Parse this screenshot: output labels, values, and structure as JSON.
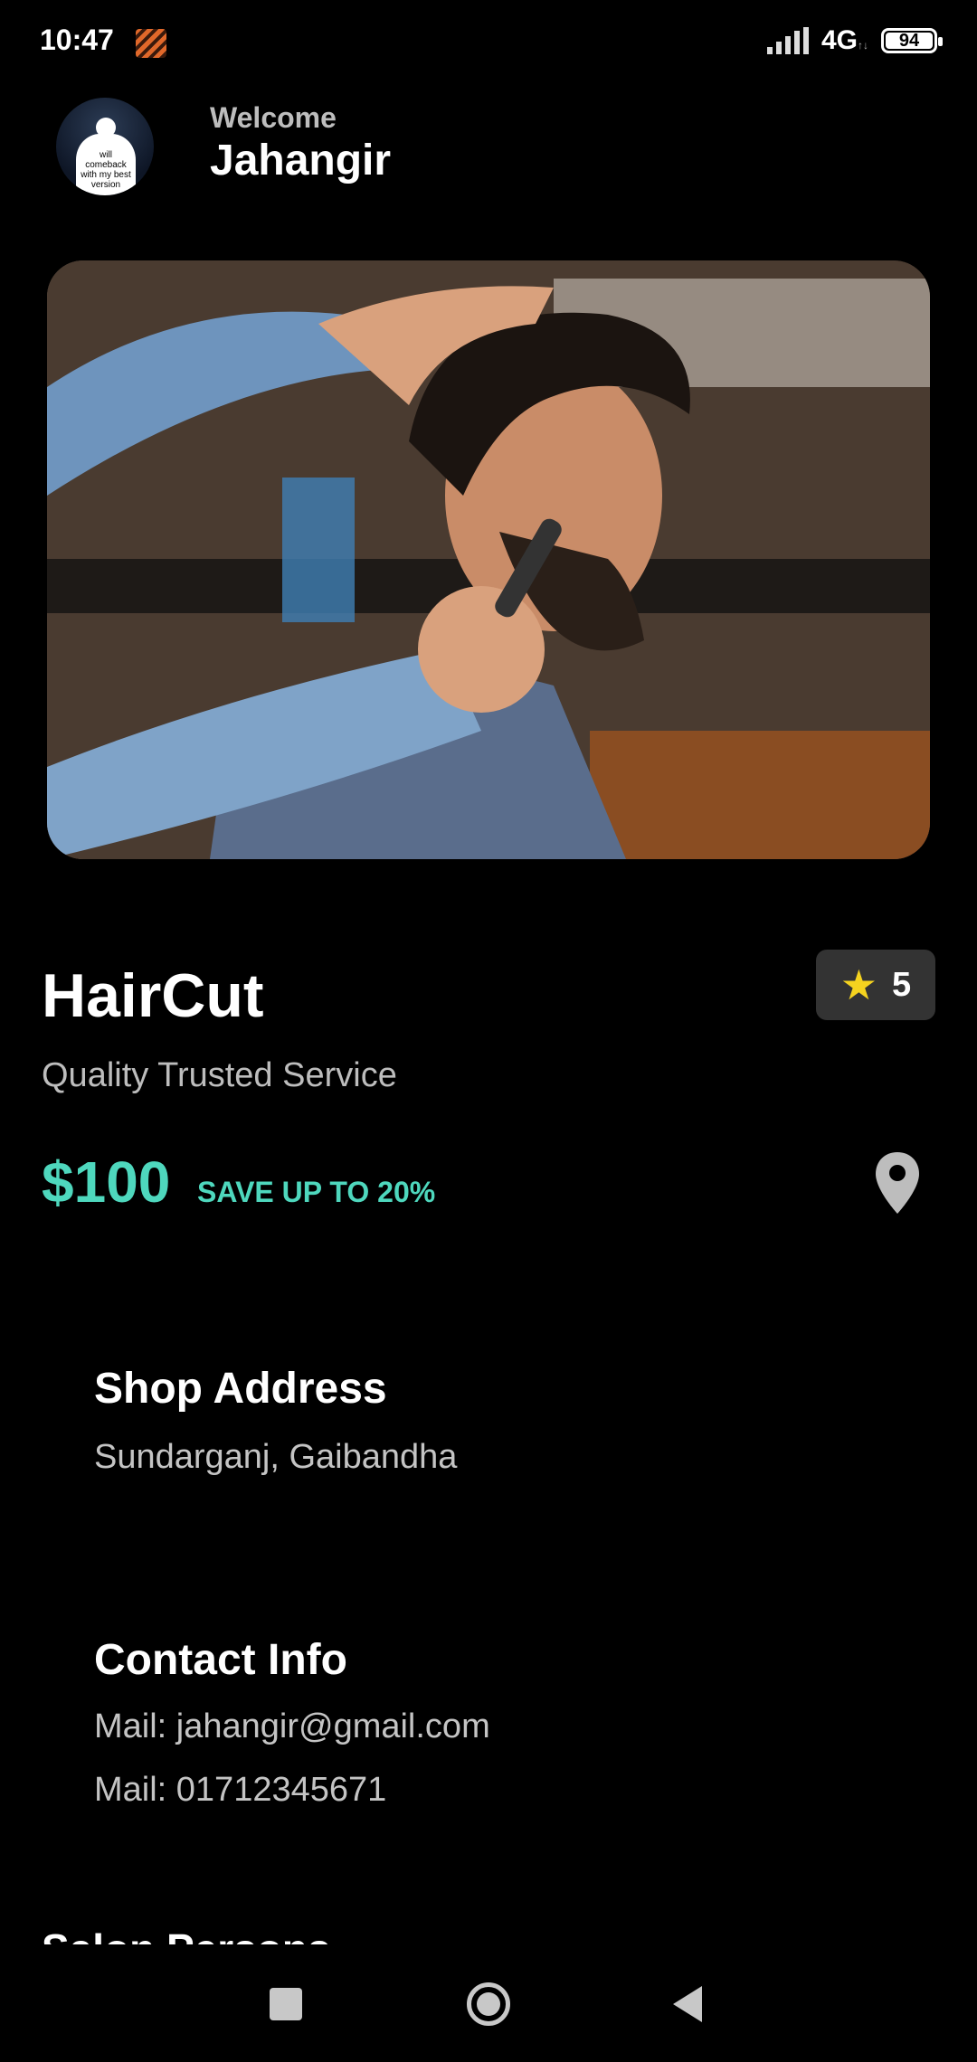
{
  "status_bar": {
    "time": "10:47",
    "network": "4G",
    "battery": "94"
  },
  "header": {
    "welcome": "Welcome",
    "username": "Jahangir",
    "avatar_caption": "will comeback with my best version"
  },
  "hero_image": {
    "description_icon": "barber-haircut-photo"
  },
  "service": {
    "title": "HairCut",
    "rating": "5",
    "subtitle": "Quality Trusted Service",
    "price": "$100",
    "discount": "SAVE UP TO 20%"
  },
  "shop_address": {
    "title": "Shop Address",
    "value": "Sundarganj, Gaibandha"
  },
  "contact_info": {
    "title": "Contact Info",
    "mail": "Mail: jahangir@gmail.com",
    "phone": "Mail: 01712345671"
  },
  "next_section_peek": "Salon Persons",
  "colors": {
    "background": "#000000",
    "accent": "#4ed7bd",
    "star": "#f5d31f",
    "badge_bg": "#333333"
  }
}
